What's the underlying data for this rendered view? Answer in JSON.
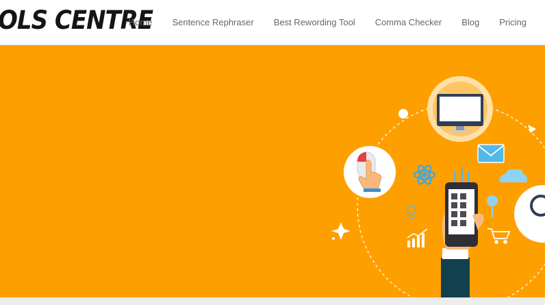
{
  "header": {
    "logo_text": "OLS CENTRE",
    "nav": [
      {
        "label": "Home"
      },
      {
        "label": "Sentence Rephraser"
      },
      {
        "label": "Best Rewording Tool"
      },
      {
        "label": "Comma Checker"
      },
      {
        "label": "Blog"
      },
      {
        "label": "Pricing"
      }
    ]
  },
  "hero": {
    "background_color": "#fe9f00",
    "illustration_icons": [
      "monitor-icon",
      "mouse-click-icon",
      "envelope-icon",
      "atom-icon",
      "cloud-icon",
      "smartphone-icon",
      "lightbulb-icon",
      "chart-icon",
      "shopping-cart-icon",
      "magnifier-icon",
      "location-pin-icon",
      "sparkle-icon"
    ]
  }
}
